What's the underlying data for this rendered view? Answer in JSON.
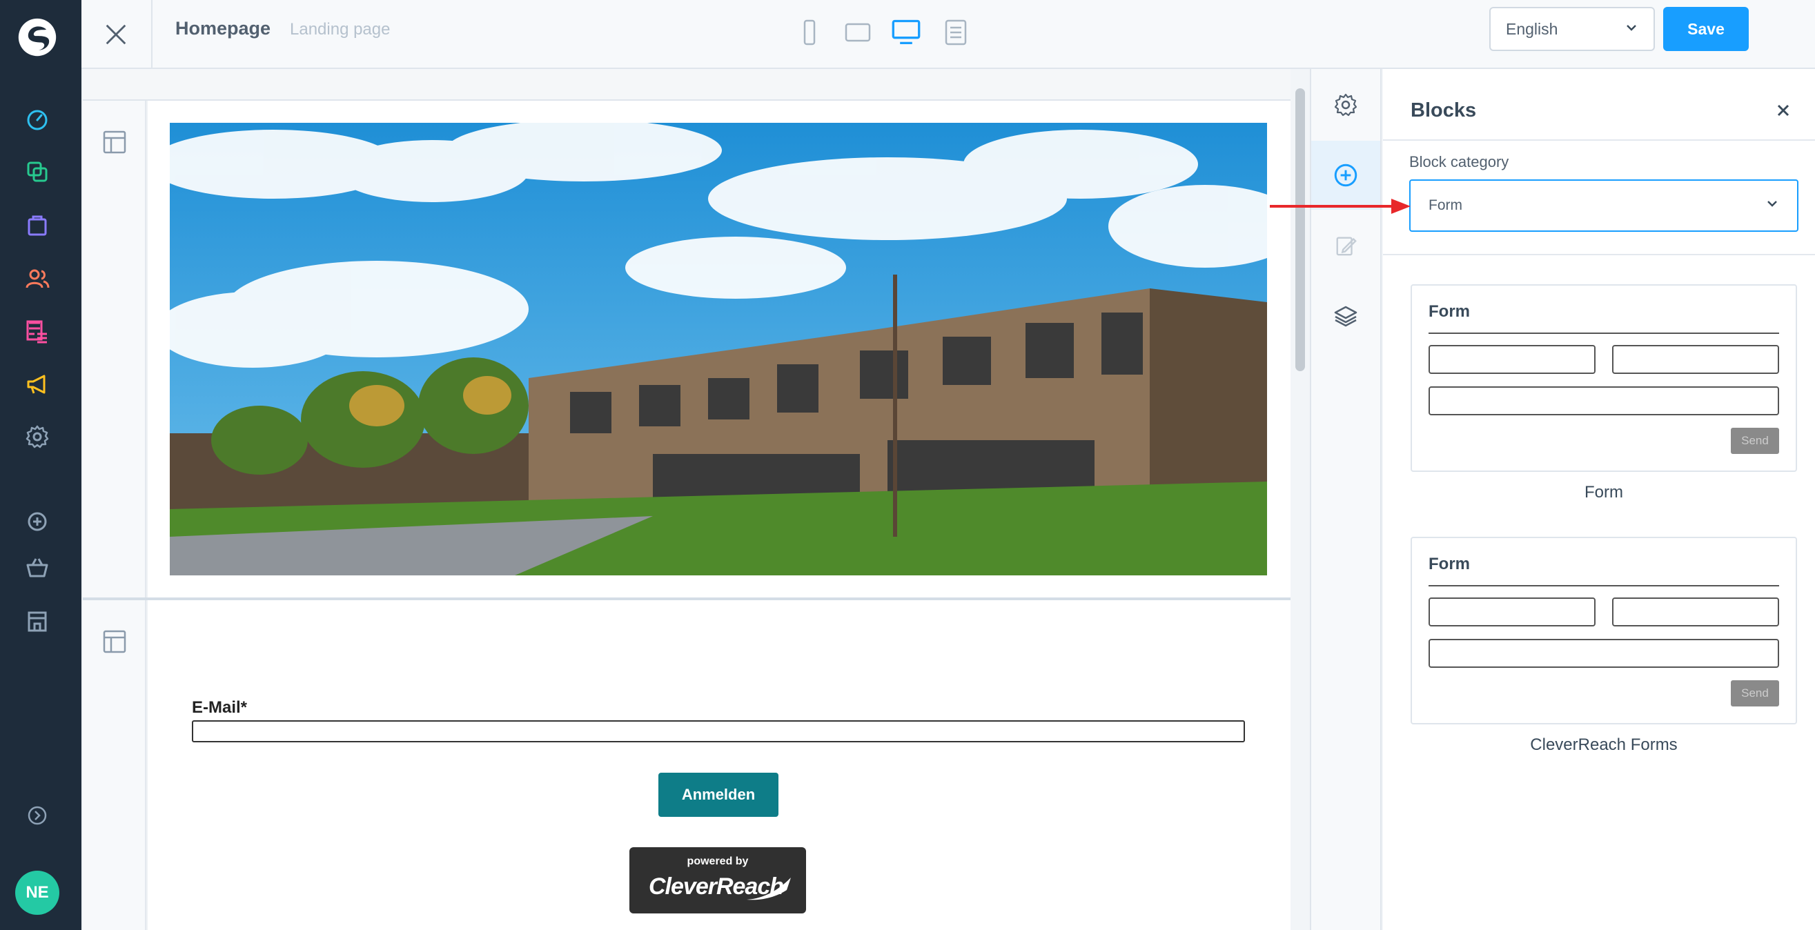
{
  "app": {
    "avatar_initials": "NE"
  },
  "sidebar": {
    "items": [
      {
        "icon": "dashboard-icon",
        "color": "#2ec0f0"
      },
      {
        "icon": "content-icon",
        "color": "#27c98f"
      },
      {
        "icon": "catalog-icon",
        "color": "#8a7bff"
      },
      {
        "icon": "customers-icon",
        "color": "#ff7b5c"
      },
      {
        "icon": "orders-icon",
        "color": "#ff4fa0"
      },
      {
        "icon": "marketing-icon",
        "color": "#ffc11f"
      },
      {
        "icon": "settings-icon",
        "color": "#8ea2b6"
      },
      {
        "icon": "add-icon",
        "color": "#8ea2b6"
      },
      {
        "icon": "basket-icon",
        "color": "#8ea2b6"
      },
      {
        "icon": "store-icon",
        "color": "#8ea2b6"
      },
      {
        "icon": "expand-icon",
        "color": "#8ea2b6"
      }
    ]
  },
  "topbar": {
    "title": "Homepage",
    "subtitle": "Landing page",
    "devices": [
      "mobile",
      "tablet",
      "desktop",
      "list"
    ],
    "active_device": "desktop",
    "language": "English",
    "save_label": "Save"
  },
  "canvas": {
    "form": {
      "email_label": "E-Mail*",
      "submit_label": "Anmelden",
      "badge_small": "powered by",
      "badge_brand": "CleverReach"
    }
  },
  "panel": {
    "title": "Blocks",
    "category_label": "Block category",
    "category_value": "Form",
    "blocks": [
      {
        "preview_title": "Form",
        "send_label": "Send",
        "caption": "Form"
      },
      {
        "preview_title": "Form",
        "send_label": "Send",
        "caption": "CleverReach Forms"
      }
    ]
  },
  "colors": {
    "accent": "#189eff",
    "sidebar_bg": "#1e2c3b",
    "submit_bg": "#0e7d88",
    "annotation_arrow": "#e8282b"
  }
}
